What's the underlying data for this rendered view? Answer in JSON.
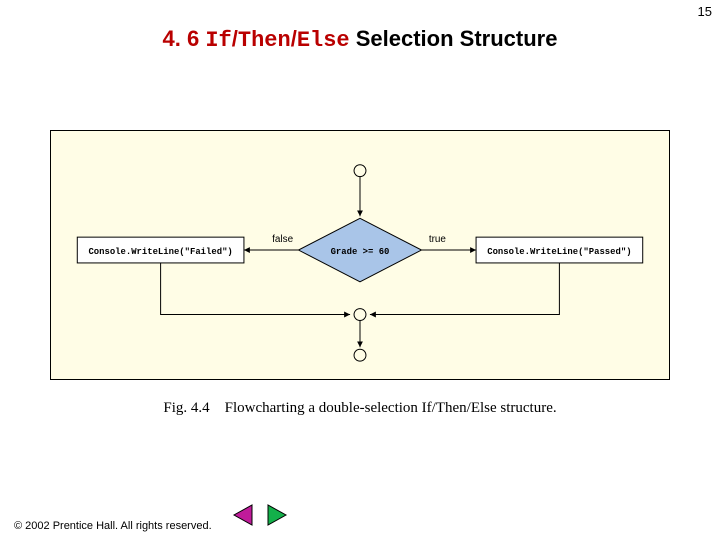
{
  "page": {
    "number": "15"
  },
  "heading": {
    "section": "4. 6 ",
    "word_if": "If",
    "slash1": "/",
    "word_then": "Then",
    "slash2": "/",
    "word_else": "Else",
    "rest": " Selection Structure"
  },
  "flowchart": {
    "left_box": "Console.WriteLine(\"Failed\")",
    "right_box": "Console.WriteLine(\"Passed\")",
    "condition": "Grade >= 60",
    "label_false": "false",
    "label_true": "true"
  },
  "caption": {
    "figlabel": "Fig. 4.4",
    "text": "Flowcharting a double-selection If/Then/Else structure."
  },
  "footer": {
    "copyright": "© 2002 Prentice Hall. All rights reserved."
  }
}
